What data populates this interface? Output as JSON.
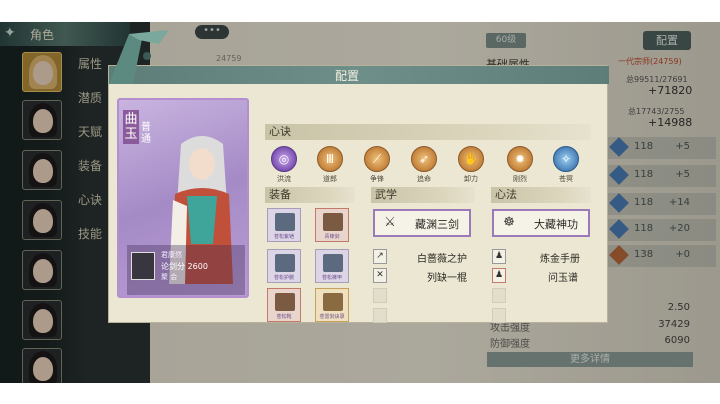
{
  "sidebar": {
    "role_tab": "角色",
    "items": [
      {
        "label": "属性"
      },
      {
        "label": "潜质"
      },
      {
        "label": "天赋"
      },
      {
        "label": "装备"
      },
      {
        "label": "心诀"
      },
      {
        "label": "技能"
      }
    ]
  },
  "header": {
    "top_value": "24759",
    "level": "60级",
    "config_button": "配置",
    "section_heading": "基础属性",
    "sect_tag": "一代宗师(24759)"
  },
  "right_stats": {
    "attack_raw": "总99511/27691",
    "attack_delta": "+71820",
    "defense_raw": "总17743/2755",
    "defense_delta": "+14988",
    "rows": [
      {
        "v1": "118",
        "v2": "+5"
      },
      {
        "v1": "118",
        "v2": "+5"
      },
      {
        "v1": "118",
        "v2": "+14"
      },
      {
        "v1": "118",
        "v2": "+20"
      },
      {
        "v1": "138",
        "v2": "+0"
      }
    ],
    "bottom": [
      {
        "label": "",
        "value": "2.50"
      },
      {
        "label": "攻击强度",
        "value": "37429"
      },
      {
        "label": "防御强度",
        "value": "6090"
      }
    ],
    "more_details": "更多详情"
  },
  "dialog": {
    "title": "配置",
    "character": {
      "name": "曲玉",
      "subtitle": "普通",
      "owner": "君康然",
      "score_label": "论剑分",
      "score": "2600",
      "rank": "聚 会"
    },
    "heart_section": "心诀",
    "skills": [
      {
        "label": "洪流",
        "icon": "vortex-icon",
        "style": "purple"
      },
      {
        "label": "道郎",
        "icon": "pillar-icon",
        "style": "gold"
      },
      {
        "label": "争锋",
        "icon": "spear-icon",
        "style": "gold"
      },
      {
        "label": "追命",
        "icon": "arrow-icon",
        "style": "gold"
      },
      {
        "label": "卸力",
        "icon": "palm-icon",
        "style": "gold"
      },
      {
        "label": "刚烈",
        "icon": "flame-icon",
        "style": "gold"
      },
      {
        "label": "苍冥",
        "icon": "orb-icon",
        "style": "blue"
      }
    ],
    "equip_section": "装备",
    "equipment": [
      {
        "tag": "苍松紫铠",
        "style": "purple"
      },
      {
        "tag": "青锋剑",
        "style": "red"
      },
      {
        "tag": "苍松护腕",
        "style": "purple"
      },
      {
        "tag": "苍松裤甲",
        "style": "purple"
      },
      {
        "tag": "苍松靴",
        "style": "red"
      },
      {
        "tag": "苍雷剑诀录",
        "style": "gold"
      }
    ],
    "martial_section": "武学",
    "martial_main": "藏渊三剑",
    "martial_subs": [
      "白蔷薇之护",
      "列缺一棍"
    ],
    "mind_section": "心法",
    "mind_main": "大藏神功",
    "mind_subs": [
      "炼金手册",
      "问玉谱"
    ]
  }
}
